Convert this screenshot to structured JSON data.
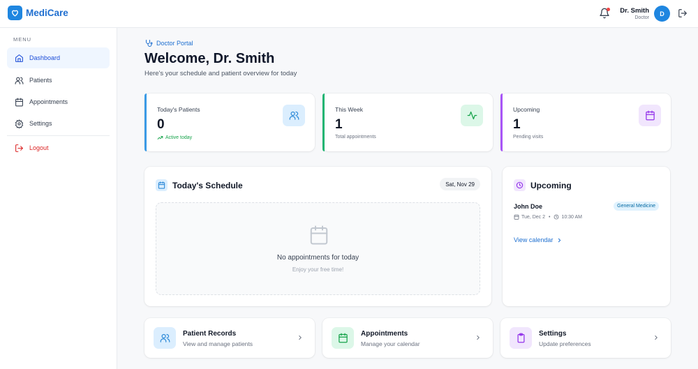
{
  "header": {
    "app_name": "MediCare",
    "user_name": "Dr. Smith",
    "user_role": "Doctor",
    "avatar_initial": "D"
  },
  "sidebar": {
    "menu_label": "MENU",
    "items": [
      {
        "label": "Dashboard",
        "icon": "home-icon",
        "active": true
      },
      {
        "label": "Patients",
        "icon": "users-icon"
      },
      {
        "label": "Appointments",
        "icon": "calendar-icon"
      },
      {
        "label": "Settings",
        "icon": "gear-icon"
      }
    ],
    "logout_label": "Logout"
  },
  "main": {
    "portal_label": "Doctor Portal",
    "welcome": "Welcome, Dr. Smith",
    "subtitle": "Here's your schedule and patient overview for today"
  },
  "stats": [
    {
      "label": "Today's Patients",
      "value": "0",
      "note": "Active today",
      "accent": "#3b9be6"
    },
    {
      "label": "This Week",
      "value": "1",
      "note": "Total appointments",
      "accent": "#22b573"
    },
    {
      "label": "Upcoming",
      "value": "1",
      "note": "Pending visits",
      "accent": "#a855f7"
    }
  ],
  "schedule": {
    "title": "Today's Schedule",
    "date": "Sat, Nov 29",
    "empty_title": "No appointments for today",
    "empty_sub": "Enjoy your free time!"
  },
  "upcoming": {
    "title": "Upcoming",
    "patient": "John Doe",
    "specialty": "General Medicine",
    "date": "Tue, Dec 2",
    "time": "10:30 AM",
    "link": "View calendar"
  },
  "quick_links": [
    {
      "title": "Patient Records",
      "subtitle": "View and manage patients"
    },
    {
      "title": "Appointments",
      "subtitle": "Manage your calendar"
    },
    {
      "title": "Settings",
      "subtitle": "Update preferences"
    }
  ]
}
